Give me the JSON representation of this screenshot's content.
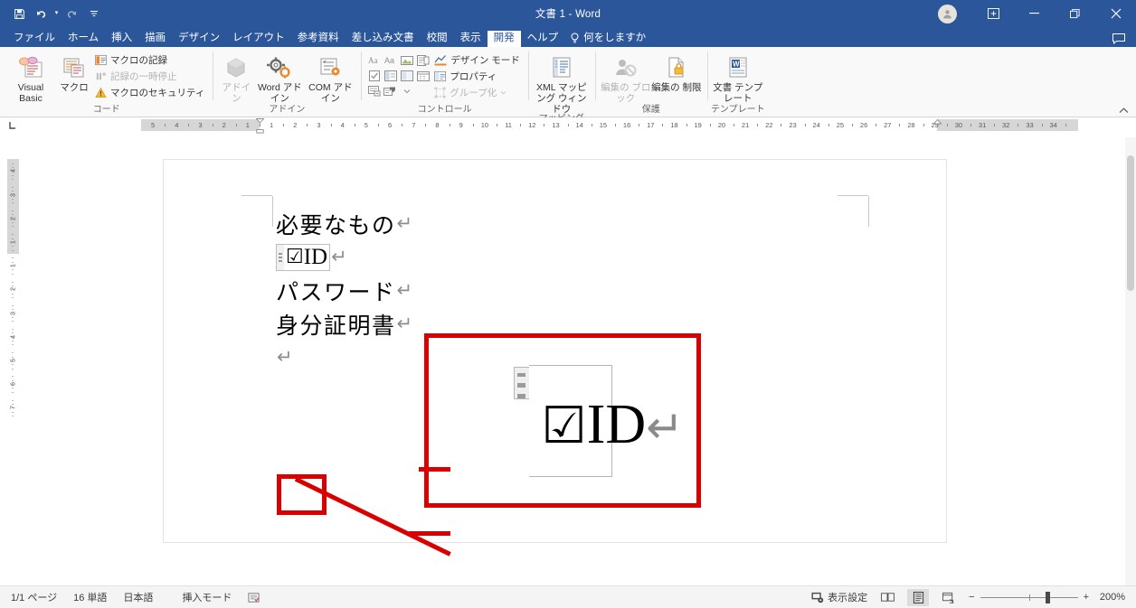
{
  "window": {
    "title": "文書 1  -  Word",
    "quick_access": [
      {
        "name": "save",
        "glyph": "ὋE"
      },
      {
        "name": "undo",
        "glyph": "↶"
      },
      {
        "name": "redo",
        "glyph": "↻"
      },
      {
        "name": "customize",
        "glyph": "⯆"
      }
    ],
    "controls": {
      "account_icon": "person-icon",
      "ribbon_display": "▣",
      "minimize": "─",
      "restore": "❐",
      "close": "✕",
      "comment": "὞8"
    }
  },
  "tabs": [
    {
      "label": "ファイル",
      "active": false
    },
    {
      "label": "ホーム",
      "active": false
    },
    {
      "label": "挿入",
      "active": false
    },
    {
      "label": "描画",
      "active": false
    },
    {
      "label": "デザイン",
      "active": false
    },
    {
      "label": "レイアウト",
      "active": false
    },
    {
      "label": "参考資料",
      "active": false
    },
    {
      "label": "差し込み文書",
      "active": false
    },
    {
      "label": "校閲",
      "active": false
    },
    {
      "label": "表示",
      "active": false
    },
    {
      "label": "開発",
      "active": true
    },
    {
      "label": "ヘルプ",
      "active": false
    }
  ],
  "tell_me": {
    "label": "何をしますか",
    "icon": "lightbulb-icon"
  },
  "ribbon": {
    "collapse_icon": "chevron-up-icon",
    "groups": [
      {
        "name": "code",
        "label": "コード",
        "big_buttons": [
          {
            "label": "Visual Basic",
            "icon": "visual-basic-icon",
            "disabled": false
          },
          {
            "label": "マクロ",
            "icon": "macro-icon",
            "disabled": false
          }
        ],
        "small_buttons": [
          {
            "label": "マクロの記録",
            "icon": "record-macro-icon",
            "disabled": false
          },
          {
            "label": "記録の一時停止",
            "icon": "pause-record-icon",
            "disabled": true
          },
          {
            "label": "マクロのセキュリティ",
            "icon": "macro-security-icon",
            "disabled": false
          }
        ]
      },
      {
        "name": "addins",
        "label": "アドイン",
        "big_buttons": [
          {
            "label": "アドイン",
            "icon": "addin-icon",
            "disabled": true
          },
          {
            "label": "Word アドイン",
            "icon": "word-addin-icon",
            "disabled": false
          },
          {
            "label": "COM アドイン",
            "icon": "com-addin-icon",
            "disabled": false
          }
        ],
        "small_buttons": []
      },
      {
        "name": "controls",
        "label": "コントロール",
        "grid_icons": [
          "rich-text-content-control-icon",
          "plain-text-content-control-icon",
          "picture-content-control-icon",
          "building-block-gallery-icon",
          "check-box-content-control-icon",
          "combo-box-content-control-icon",
          "drop-down-list-content-control-icon",
          "date-picker-content-control-icon",
          "repeating-section-content-control-icon",
          "legacy-tools-icon"
        ],
        "small_buttons": [
          {
            "label": "デザイン モード",
            "icon": "design-mode-icon",
            "disabled": false
          },
          {
            "label": "プロパティ",
            "icon": "properties-icon",
            "disabled": false
          },
          {
            "label": "グループ化",
            "icon": "group-icon",
            "disabled": true
          }
        ]
      },
      {
        "name": "mapping",
        "label": "マッピング",
        "big_buttons": [
          {
            "label": "XML マッピング ウィンドウ",
            "icon": "xml-mapping-icon",
            "disabled": false
          }
        ],
        "small_buttons": []
      },
      {
        "name": "protect",
        "label": "保護",
        "big_buttons": [
          {
            "label": "編集の ブロック",
            "icon": "block-authors-icon",
            "disabled": true
          },
          {
            "label": "編集の 制限",
            "icon": "restrict-editing-icon",
            "disabled": false
          }
        ],
        "small_buttons": []
      },
      {
        "name": "templates",
        "label": "テンプレート",
        "big_buttons": [
          {
            "label": "文書 テンプレート",
            "icon": "document-template-icon",
            "disabled": false
          }
        ],
        "small_buttons": []
      }
    ]
  },
  "ruler": {
    "corner_icon": "tab-stop-icon",
    "horizontal_left_ticks": [
      "5",
      "4",
      "3",
      "2",
      "1"
    ],
    "horizontal_right_ticks": [
      "1",
      "2",
      "3",
      "4",
      "5",
      "6",
      "7",
      "8",
      "9",
      "10",
      "11",
      "12",
      "13",
      "14",
      "15",
      "16",
      "17",
      "18",
      "19",
      "20",
      "21",
      "22",
      "23",
      "24",
      "25",
      "26",
      "27",
      "28",
      "29",
      "30",
      "31",
      "32",
      "33",
      "34"
    ],
    "vertical_ticks_top": [
      "4",
      "3",
      "2",
      "1"
    ],
    "vertical_ticks_body": [
      "1",
      "2",
      "3",
      "4",
      "5",
      "6",
      "7"
    ],
    "left_indent_marker": "left-indent-marker",
    "right_indent_marker": "right-indent-marker"
  },
  "document": {
    "lines": [
      {
        "text": "必要なもの",
        "pilcrow": "↵",
        "type": "text"
      },
      {
        "text": "ID",
        "pilcrow": "↵",
        "type": "content-control",
        "checkbox": "☑"
      },
      {
        "text": "パスワード",
        "pilcrow": "↵",
        "type": "text"
      },
      {
        "text": "身分証明書",
        "pilcrow": "↵",
        "type": "text"
      },
      {
        "text": "",
        "pilcrow": "↵",
        "type": "text"
      }
    ]
  },
  "annotation": {
    "highlight_color": "#d80000",
    "callout": {
      "checkbox": "☑",
      "text": "ID",
      "pilcrow": "↵",
      "grip_icon": "content-control-grip-icon"
    }
  },
  "status_bar": {
    "page": "1/1 ページ",
    "words": "16 単語",
    "language": "日本語",
    "mode": "挿入モード",
    "proofing_icon": "proofing-icon",
    "display_settings": "表示設定",
    "display_settings_icon": "display-settings-icon",
    "views": [
      {
        "name": "read-mode-view",
        "icon": "▭",
        "selected": false
      },
      {
        "name": "print-layout-view",
        "icon": "▤",
        "selected": true
      },
      {
        "name": "web-layout-view",
        "icon": "▧",
        "selected": false
      }
    ],
    "zoom_out": "−",
    "zoom_in": "+",
    "zoom_level": "200%"
  }
}
